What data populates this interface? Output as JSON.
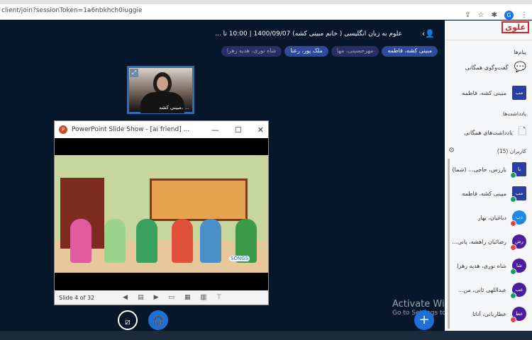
{
  "browser": {
    "url": "client/join?sessionToken=1a6nbkhch0iuggie"
  },
  "header": {
    "title": "علوم به زبان انگلیسی ( خانم مبینی کشه) 1400/09/07 | 10:00 تا ...",
    "speakers": [
      {
        "name": "مبینی کشه، فاطمه",
        "active": true
      },
      {
        "name": "مهرحسینی، مها",
        "active": false
      },
      {
        "name": "ملک پور، رعنا",
        "active": true
      },
      {
        "name": "شاه نوری، هدیه زهرا",
        "active": false
      }
    ]
  },
  "webcam": {
    "label": "مبینی کشه، ..."
  },
  "powerpoint": {
    "title": "PowerPoint Slide Show - [ai friend] ...",
    "slide_status": "Slide 4 of 32",
    "watermark": "SONGS"
  },
  "windows": {
    "line1": "Activate Windows",
    "line2": "Go to Settings to activate Windows."
  },
  "sidebar": {
    "logo": "علوی",
    "messages_heading": "پیام‌ها",
    "public_chat": "گفت‌وگوی همگانی",
    "chat_user": {
      "initials": "مب",
      "name": "مبینی کشه، فاطمه"
    },
    "notes_heading": "یادداشت‌ها",
    "public_notes": "یادداشت‌های همگانی",
    "users_heading": "کاربران (15)",
    "users": [
      {
        "initials": "با",
        "name": "بارزس، حاجی... (شما)",
        "status": "online",
        "shape": "square"
      },
      {
        "initials": "مب",
        "name": "مبینی کشه، فاطمه",
        "status": "online",
        "shape": "square"
      },
      {
        "initials": "دب",
        "name": "دباغیان، بهار",
        "status": "muted",
        "shape": "blue"
      },
      {
        "initials": "رض",
        "name": "رضائیان راهشه، پانی...",
        "status": "muted",
        "shape": "round"
      },
      {
        "initials": "شا",
        "name": "شاه نوری، هدیه زهرا",
        "status": "online",
        "shape": "round"
      },
      {
        "initials": "عب",
        "name": "عبداللهی ثانی، من...",
        "status": "online",
        "shape": "round"
      },
      {
        "initials": "عط",
        "name": "عطاریانی، آناتا",
        "status": "muted",
        "shape": "round"
      }
    ]
  }
}
